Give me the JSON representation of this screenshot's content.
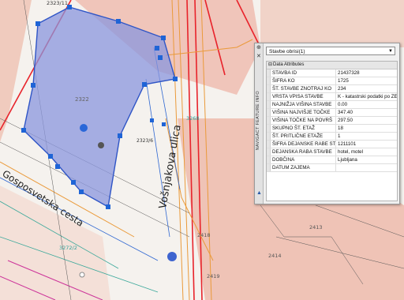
{
  "map": {
    "street_labels": [
      "Vošnjakova ulica",
      "Gosposvetska cesta"
    ],
    "parcel_labels": [
      "2323/11",
      "2322",
      "2323/6",
      "3268",
      "3272/2",
      "2418",
      "2413",
      "2414",
      "2419"
    ],
    "colors": {
      "polygon_fill": "#8a95dd",
      "polygon_stroke": "#2f55c6",
      "vertex": "#1f64d6",
      "parcel_fill": "#eeb6a8",
      "road_line": "#e8232b",
      "orange_line": "#ea9a3a",
      "blue_line": "#2d66d1",
      "teal_line": "#3aa89a",
      "magenta_line": "#cc3399"
    }
  },
  "panel": {
    "side_label": "NAVIGACT FEATURE INFO",
    "pin_icon": "pin-icon",
    "close_icon": "close-icon",
    "layer_select": "Stavbe obrisi(1)",
    "section_header": "Data Attributes",
    "attributes": [
      {
        "key": "STAVBA ID",
        "value": "21437328"
      },
      {
        "key": "ŠIFRA KO",
        "value": "1725"
      },
      {
        "key": "ŠT. STAVBE ZNOTRAJ KO",
        "value": "234"
      },
      {
        "key": "VRSTA VPISA STAVBE",
        "value": "K - katastrski podatki po ZEN"
      },
      {
        "key": "NAJNIŽJA VIŠINA STAVBE",
        "value": "0.00"
      },
      {
        "key": "VIŠINA NAJVIŠJE TOČKE",
        "value": "347.40"
      },
      {
        "key": "VIŠINA TOČKE NA POVRŠ",
        "value": "297.50"
      },
      {
        "key": "SKUPNO ŠT. ETAŽ",
        "value": "18"
      },
      {
        "key": "ŠT. PRITLIČNE ETAŽE",
        "value": "1"
      },
      {
        "key": "ŠIFRA DEJANSKE RABE STA",
        "value": "1211101"
      },
      {
        "key": "DEJANSKA RABA STAVBE",
        "value": "hotel, motel"
      },
      {
        "key": "DOBČINA",
        "value": "Ljubljana"
      },
      {
        "key": "DATUM ZAJEMA",
        "value": ""
      }
    ]
  }
}
